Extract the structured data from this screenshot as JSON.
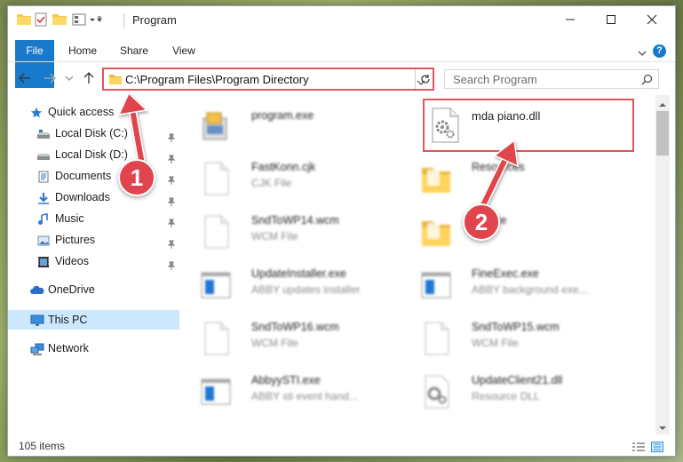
{
  "window": {
    "title": "Program"
  },
  "ribbon": {
    "tabs": [
      "File",
      "Home",
      "Share",
      "View"
    ],
    "help_label": "?"
  },
  "nav": {
    "address": "C:\\Program Files\\Program Directory",
    "search_placeholder": "Search Program"
  },
  "sidebar": {
    "items": [
      {
        "label": "Quick access",
        "icon": "star-icon"
      },
      {
        "label": "Local Disk (C:)",
        "icon": "drive-icon",
        "pinned": true
      },
      {
        "label": "Local Disk (D:)",
        "icon": "drive-icon",
        "pinned": true
      },
      {
        "label": "Documents",
        "icon": "documents-icon",
        "pinned": true
      },
      {
        "label": "Downloads",
        "icon": "download-icon",
        "pinned": true
      },
      {
        "label": "Music",
        "icon": "music-icon",
        "pinned": true
      },
      {
        "label": "Pictures",
        "icon": "pictures-icon",
        "pinned": true
      },
      {
        "label": "Videos",
        "icon": "videos-icon",
        "pinned": true
      },
      {
        "label": "OneDrive",
        "icon": "cloud-icon"
      },
      {
        "label": "This PC",
        "icon": "computer-icon",
        "selected": true
      },
      {
        "label": "Network",
        "icon": "network-icon"
      }
    ]
  },
  "files": [
    {
      "name": "program.exe",
      "desc": "",
      "icon": "exe-icon"
    },
    {
      "name": "mda piano.dll",
      "desc": "",
      "icon": "dll-gear-icon"
    },
    {
      "name": "FastKonn.cjk",
      "desc": "CJK File",
      "icon": "blank-file-icon"
    },
    {
      "name": "Resources",
      "desc": "",
      "icon": "folder-icon"
    },
    {
      "name": "SndToWP14.wcm",
      "desc": "WCM File",
      "icon": "blank-file-icon"
    },
    {
      "name": "Source",
      "desc": "",
      "icon": "folder-icon"
    },
    {
      "name": "UpdateInstaller.exe",
      "desc": "ABBY updates installer",
      "icon": "app-window-icon"
    },
    {
      "name": "FineExec.exe",
      "desc": "ABBY background exe...",
      "icon": "app-window-icon"
    },
    {
      "name": "SndToWP16.wcm",
      "desc": "WCM File",
      "icon": "blank-file-icon"
    },
    {
      "name": "SndToWP15.wcm",
      "desc": "WCM File",
      "icon": "blank-file-icon"
    },
    {
      "name": "AbbyySTI.exe",
      "desc": "ABBY sti event hand...",
      "icon": "app-window-icon"
    },
    {
      "name": "UpdateClient21.dll",
      "desc": "Resource DLL",
      "icon": "dll-gear-icon"
    }
  ],
  "status": {
    "item_count": "105 items"
  },
  "annotations": {
    "step1": "1",
    "step2": "2",
    "color": "#e0444c"
  },
  "colors": {
    "accent": "#1979ca",
    "highlight": "#e05560",
    "selected_bg": "#cce8ff"
  }
}
